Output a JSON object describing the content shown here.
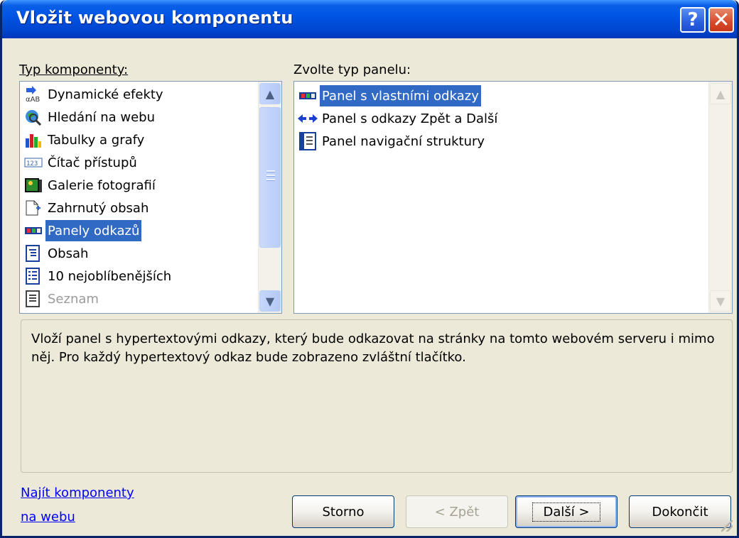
{
  "window": {
    "title": "Vložit webovou komponentu",
    "help_label": "?",
    "close_label": "✕"
  },
  "components_label": "Typ komponenty:",
  "components": [
    {
      "label": "Dynamické efekty",
      "icon": "dynamic-effects-icon",
      "selected": false,
      "disabled": false
    },
    {
      "label": "Hledání na webu",
      "icon": "web-search-icon",
      "selected": false,
      "disabled": false
    },
    {
      "label": "Tabulky a grafy",
      "icon": "charts-icon",
      "selected": false,
      "disabled": false
    },
    {
      "label": "Čítač přístupů",
      "icon": "hit-counter-icon",
      "selected": false,
      "disabled": false
    },
    {
      "label": "Galerie fotografií",
      "icon": "photo-gallery-icon",
      "selected": false,
      "disabled": false
    },
    {
      "label": "Zahrnutý obsah",
      "icon": "included-content-icon",
      "selected": false,
      "disabled": false
    },
    {
      "label": "Panely odkazů",
      "icon": "link-bar-icon",
      "selected": true,
      "disabled": false
    },
    {
      "label": "Obsah",
      "icon": "table-of-contents-icon",
      "selected": false,
      "disabled": false
    },
    {
      "label": "10 nejoblíbenějších",
      "icon": "top-ten-list-icon",
      "selected": false,
      "disabled": false
    },
    {
      "label": "Seznam",
      "icon": "list-icon",
      "selected": false,
      "disabled": true
    }
  ],
  "panel_type_label": "Zvolte typ panelu:",
  "panel_types": [
    {
      "label": "Panel s vlastními odkazy",
      "icon": "custom-links-bar-icon",
      "selected": true
    },
    {
      "label": "Panel s odkazy Zpět a Další",
      "icon": "back-next-arrows-icon",
      "selected": false
    },
    {
      "label": "Panel navigační struktury",
      "icon": "navigation-structure-icon",
      "selected": false
    }
  ],
  "description": "Vloží panel s hypertextovými odkazy, který bude odkazovat na stránky na tomto webovém serveru i mimo něj. Pro každý hypertextový odkaz bude zobrazeno zvláštní tlačítko.",
  "find_link_line1": "Najít komponenty",
  "find_link_line2": "na webu",
  "buttons": {
    "cancel": "Storno",
    "back": "< Zpět",
    "next": "Další >",
    "finish": "Dokončit"
  },
  "colors": {
    "title_bar": "#0055E5",
    "selection": "#316AC5",
    "dialog_bg": "#ECE9D8",
    "link": "#0000FF"
  }
}
